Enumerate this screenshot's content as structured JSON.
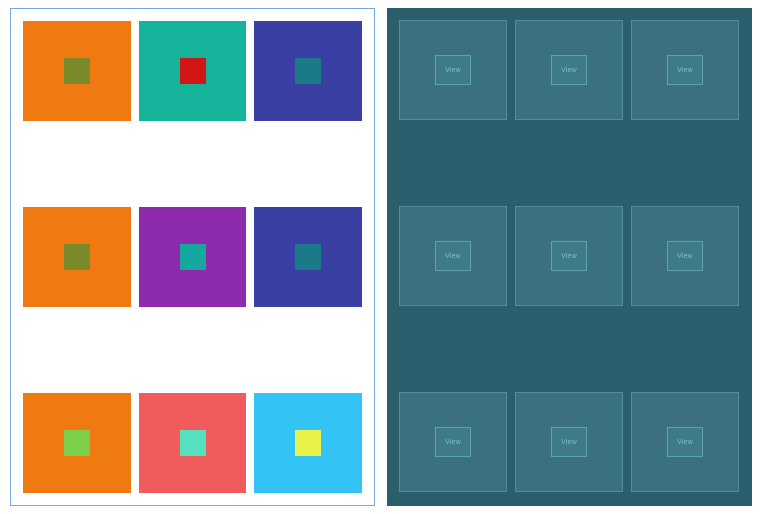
{
  "left": {
    "border_color": "#7aa9e0",
    "background": "#ffffff",
    "rows": [
      [
        {
          "bg": "#f07a12",
          "inner": "#7a8a2a"
        },
        {
          "bg": "#14b39a",
          "inner": "#d41515"
        },
        {
          "bg": "#3a3fa3",
          "inner": "#1a7a88"
        }
      ],
      [
        {
          "bg": "#f07a12",
          "inner": "#7a8a2a"
        },
        {
          "bg": "#8e2aad",
          "inner": "#16a89e"
        },
        {
          "bg": "#3a3fa3",
          "inner": "#1a7a88"
        }
      ],
      [
        {
          "bg": "#f07a12",
          "inner": "#7ed04a"
        },
        {
          "bg": "#f15b5b",
          "inner": "#55e0c0"
        },
        {
          "bg": "#33c4f5",
          "inner": "#e9f24a"
        }
      ]
    ]
  },
  "right": {
    "background": "#2a5e6c",
    "tile_bg": "#3a7080",
    "tile_border": "#4f8e9b",
    "inner_bg": "#3f7a89",
    "inner_border": "#5da3b0",
    "label_color": "#7fbecc",
    "rows": [
      [
        {
          "label": "View"
        },
        {
          "label": "View"
        },
        {
          "label": "View"
        }
      ],
      [
        {
          "label": "View"
        },
        {
          "label": "View"
        },
        {
          "label": "View"
        }
      ],
      [
        {
          "label": "View"
        },
        {
          "label": "View"
        },
        {
          "label": "View"
        }
      ]
    ]
  }
}
